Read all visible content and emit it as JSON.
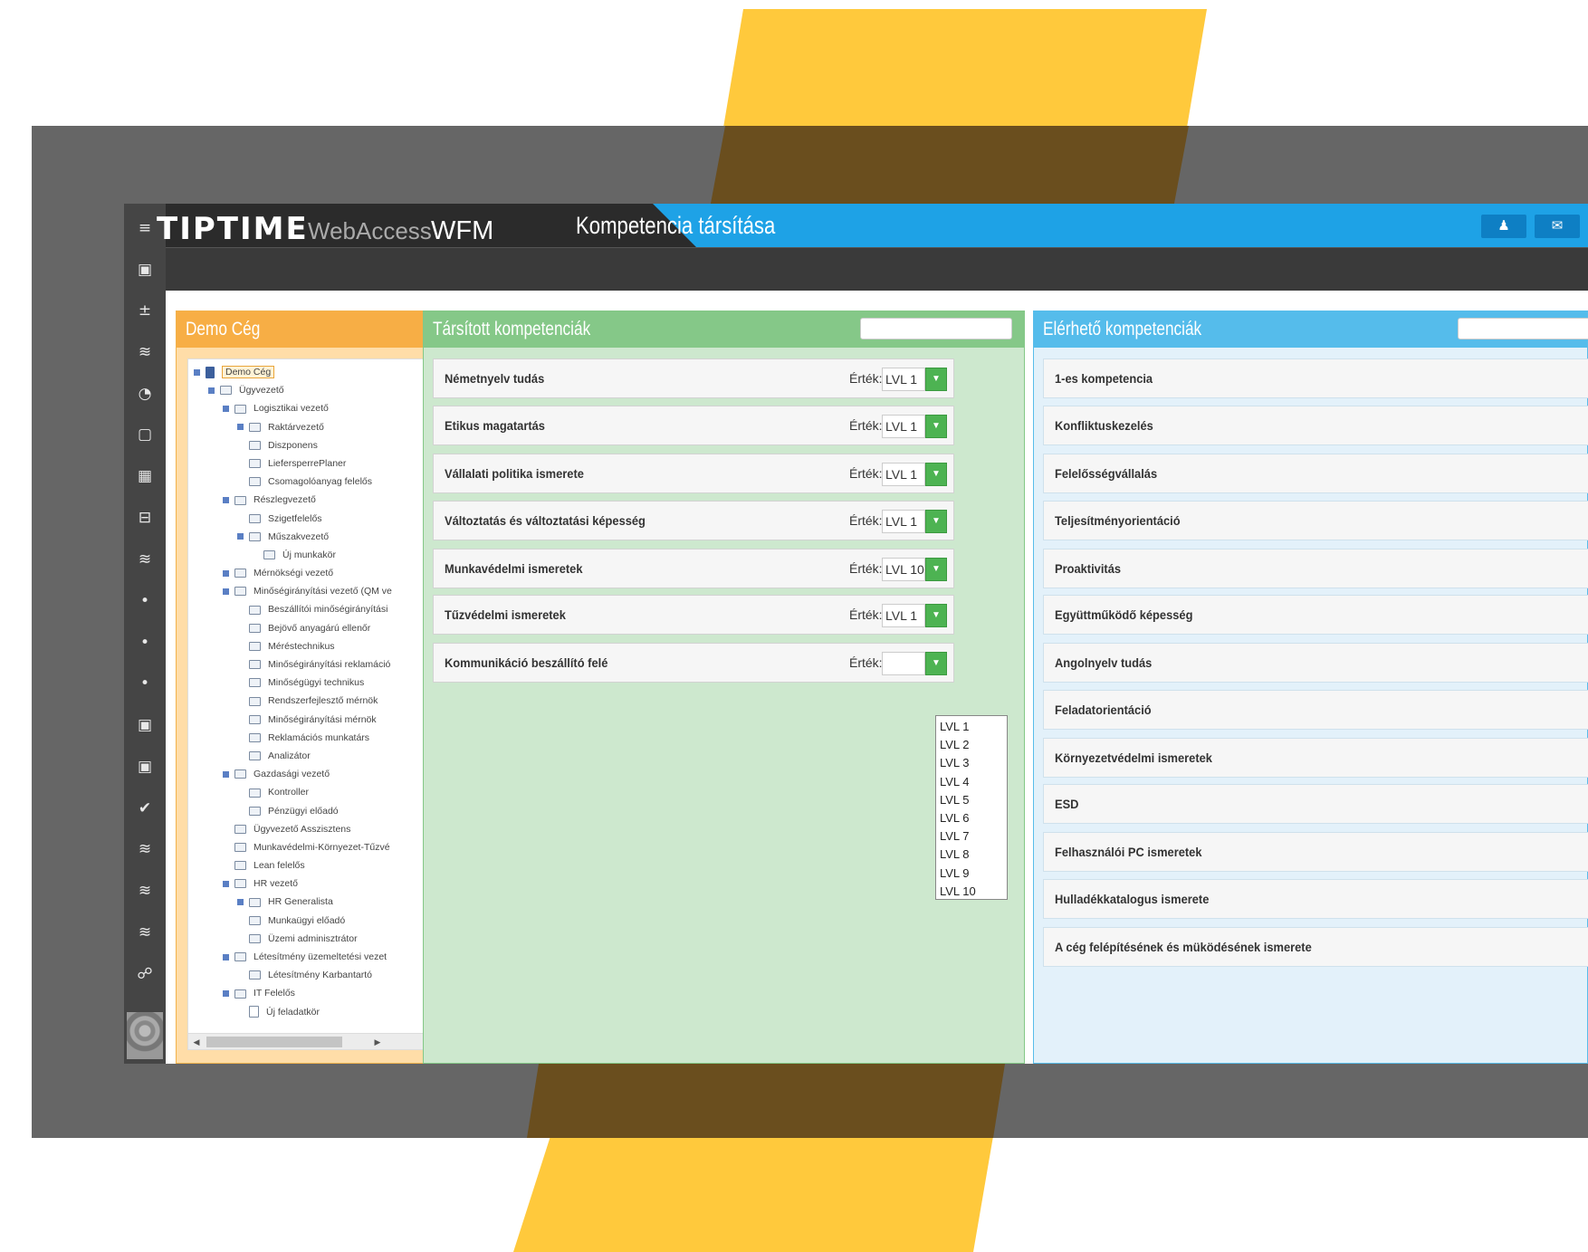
{
  "header": {
    "logo_main": "TIPTIME",
    "logo_web": "WebAccess",
    "logo_wfm": "WFM",
    "page_title": "Kompetencia társítása"
  },
  "sidebar_icons": [
    {
      "name": "menu-icon",
      "glyph": "≡"
    },
    {
      "name": "document-icon",
      "glyph": "▣"
    },
    {
      "name": "plus-minus-icon",
      "glyph": "±"
    },
    {
      "name": "database-icon",
      "glyph": "≋"
    },
    {
      "name": "pie-icon",
      "glyph": "◔"
    },
    {
      "name": "file-icon",
      "glyph": "▢"
    },
    {
      "name": "calendar-icon",
      "glyph": "▦"
    },
    {
      "name": "folder-icon",
      "glyph": "⊟"
    },
    {
      "name": "database-icon",
      "glyph": "≋"
    },
    {
      "name": "dot-icon",
      "glyph": "•"
    },
    {
      "name": "dot-icon",
      "glyph": "•"
    },
    {
      "name": "dot-icon",
      "glyph": "•"
    },
    {
      "name": "document-icon",
      "glyph": "▣"
    },
    {
      "name": "document-icon",
      "glyph": "▣"
    },
    {
      "name": "check-icon",
      "glyph": "✔"
    },
    {
      "name": "database-icon",
      "glyph": "≋"
    },
    {
      "name": "database-icon",
      "glyph": "≋"
    },
    {
      "name": "database-icon",
      "glyph": "≋"
    },
    {
      "name": "users-icon",
      "glyph": "☍"
    }
  ],
  "tree_panel": {
    "title": "Demo Cég",
    "items": [
      {
        "label": "Demo Cég",
        "level": 0,
        "exp": true,
        "type": "root",
        "selected": true
      },
      {
        "label": "Ügyvezető",
        "level": 1,
        "exp": true
      },
      {
        "label": "Logisztikai vezető",
        "level": 2,
        "exp": true
      },
      {
        "label": "Raktárvezető",
        "level": 3,
        "exp": true
      },
      {
        "label": "Diszponens",
        "level": 3,
        "exp": false
      },
      {
        "label": "LiefersperrePlaner",
        "level": 3,
        "exp": false
      },
      {
        "label": "Csomagolóanyag felelős",
        "level": 3,
        "exp": false
      },
      {
        "label": "Részlegvezető",
        "level": 2,
        "exp": true
      },
      {
        "label": "Szigetfelelős",
        "level": 3,
        "exp": false
      },
      {
        "label": "Műszakvezető",
        "level": 3,
        "exp": true
      },
      {
        "label": "Új munkakör",
        "level": 4,
        "exp": false
      },
      {
        "label": "Mérnökségi vezető",
        "level": 2,
        "exp": true
      },
      {
        "label": "Minőségirányítási vezető (QM ve",
        "level": 2,
        "exp": true
      },
      {
        "label": "Beszállítói minőségirányítási",
        "level": 3,
        "exp": false
      },
      {
        "label": "Bejövő anyagárú ellenőr",
        "level": 3,
        "exp": false
      },
      {
        "label": "Méréstechnikus",
        "level": 3,
        "exp": false
      },
      {
        "label": "Minőségirányítási reklamáció",
        "level": 3,
        "exp": false
      },
      {
        "label": "Minőségügyi technikus",
        "level": 3,
        "exp": false
      },
      {
        "label": "Rendszerfejlesztő mérnök",
        "level": 3,
        "exp": false
      },
      {
        "label": "Minőségirányítási mérnök",
        "level": 3,
        "exp": false
      },
      {
        "label": "Reklamációs munkatárs",
        "level": 3,
        "exp": false
      },
      {
        "label": "Analizátor",
        "level": 3,
        "exp": false
      },
      {
        "label": "Gazdasági vezető",
        "level": 2,
        "exp": true
      },
      {
        "label": "Kontroller",
        "level": 3,
        "exp": false
      },
      {
        "label": "Pénzügyi előadó",
        "level": 3,
        "exp": false
      },
      {
        "label": "Ügyvezető Asszisztens",
        "level": 2,
        "exp": false
      },
      {
        "label": "Munkavédelmi-Környezet-Tűzvé",
        "level": 2,
        "exp": false
      },
      {
        "label": "Lean felelős",
        "level": 2,
        "exp": false
      },
      {
        "label": "HR vezető",
        "level": 2,
        "exp": true
      },
      {
        "label": "HR Generalista",
        "level": 3,
        "exp": true
      },
      {
        "label": "Munkaügyi előadó",
        "level": 3,
        "exp": false
      },
      {
        "label": "Üzemi adminisztrátor",
        "level": 3,
        "exp": false
      },
      {
        "label": "Létesítmény üzemeltetési vezet",
        "level": 2,
        "exp": true
      },
      {
        "label": "Létesítmény Karbantartó",
        "level": 3,
        "exp": false
      },
      {
        "label": "IT Felelős",
        "level": 2,
        "exp": true
      },
      {
        "label": "Új feladatkör",
        "level": 3,
        "exp": false,
        "type": "doc"
      }
    ]
  },
  "assigned_panel": {
    "title": "Társított kompetenciák",
    "value_label": "Érték:",
    "rows": [
      {
        "name": "Németnyelv tudás",
        "value": "LVL 1"
      },
      {
        "name": "Etikus magatartás",
        "value": "LVL 1"
      },
      {
        "name": "Vállalati politika ismerete",
        "value": "LVL 1"
      },
      {
        "name": "Változtatás és változtatási képesség",
        "value": "LVL 1"
      },
      {
        "name": "Munkavédelmi ismeretek",
        "value": "LVL 10"
      },
      {
        "name": "Tűzvédelmi ismeretek",
        "value": "LVL 1"
      },
      {
        "name": "Kommunikáció beszállító felé",
        "value": ""
      }
    ],
    "dropdown_options": [
      "LVL 1",
      "LVL 2",
      "LVL 3",
      "LVL 4",
      "LVL 5",
      "LVL 6",
      "LVL 7",
      "LVL 8",
      "LVL 9",
      "LVL 10"
    ]
  },
  "available_panel": {
    "title": "Elérhető kompetenciák",
    "rows": [
      "1-es kompetencia",
      "Konfliktuskezelés",
      "Felelősségvállalás",
      "Teljesítményorientáció",
      "Proaktivitás",
      "Együttműködő képesség",
      "Angolnyelv tudás",
      "Feladatorientáció",
      "Környezetvédelmi ismeretek",
      "ESD",
      "Felhasználói PC ismeretek",
      "Hulladékkatalogus ismerete",
      "A cég felépítésének és müködésének ismerete"
    ]
  },
  "colors": {
    "accent_yellow": "#FFC93C",
    "title_blue": "#1EA2E6",
    "tree_orange": "#F7AE45",
    "assigned_green": "#85C888",
    "available_blue": "#55BCEB",
    "dropdown_green": "#4DB352"
  }
}
